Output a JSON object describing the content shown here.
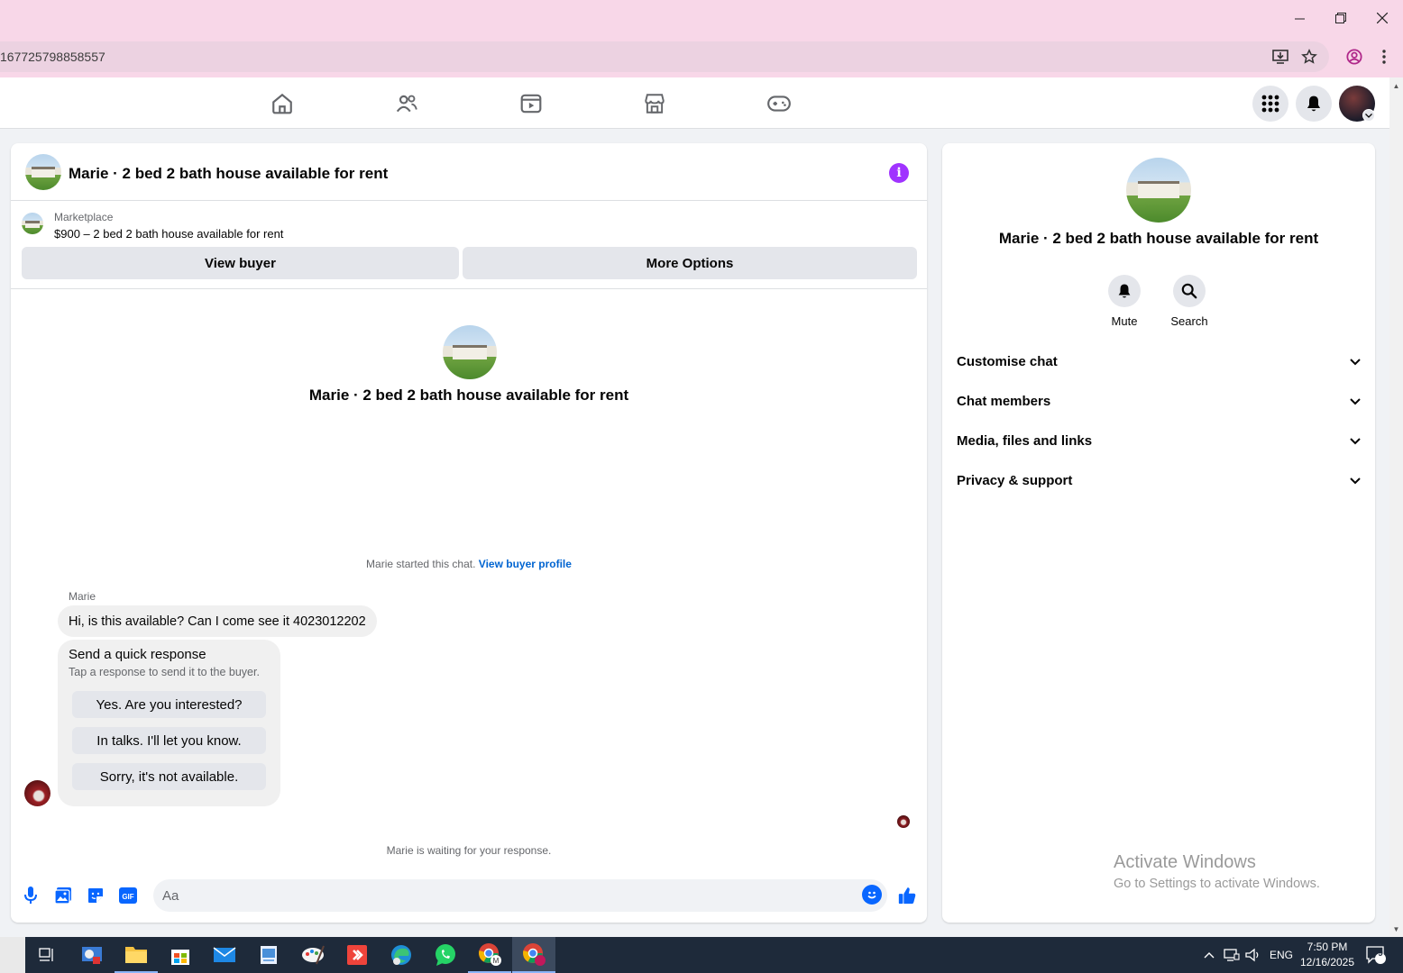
{
  "browser": {
    "url_fragment": "167725798858557"
  },
  "conversation": {
    "title": "Marie · 2 bed 2 bath house available for rent",
    "marketplace_label": "Marketplace",
    "listing": "$900 – 2 bed 2 bath house available for rent",
    "view_buyer": "View buyer",
    "more_options": "More Options",
    "started_text": "Marie started this chat.",
    "view_buyer_profile": "View buyer profile",
    "sender_name": "Marie",
    "message": "Hi, is this available? Can I come see it 4023012202",
    "quick_response": {
      "title": "Send a quick response",
      "subtitle": "Tap a response to send it to the buyer.",
      "options": [
        "Yes. Are you interested?",
        "In talks. I'll let you know.",
        "Sorry, it's not available."
      ]
    },
    "waiting_text": "Marie is waiting for your response.",
    "input_placeholder": "Aa"
  },
  "info_panel": {
    "name": "Marie · 2 bed 2 bath house available for rent",
    "actions": [
      "Mute",
      "Search"
    ],
    "sections": [
      "Customise chat",
      "Chat members",
      "Media, files and links",
      "Privacy & support"
    ]
  },
  "watermark": {
    "line1": "Activate Windows",
    "line2": "Go to Settings to activate Windows."
  },
  "taskbar": {
    "language": "ENG",
    "time": "7:50 PM",
    "date": "12/16/2025",
    "notification_count": "9"
  },
  "colors": {
    "accent_blue": "#0866ff",
    "info_purple": "#a033ff",
    "browser_pink": "#f8d7e8"
  }
}
